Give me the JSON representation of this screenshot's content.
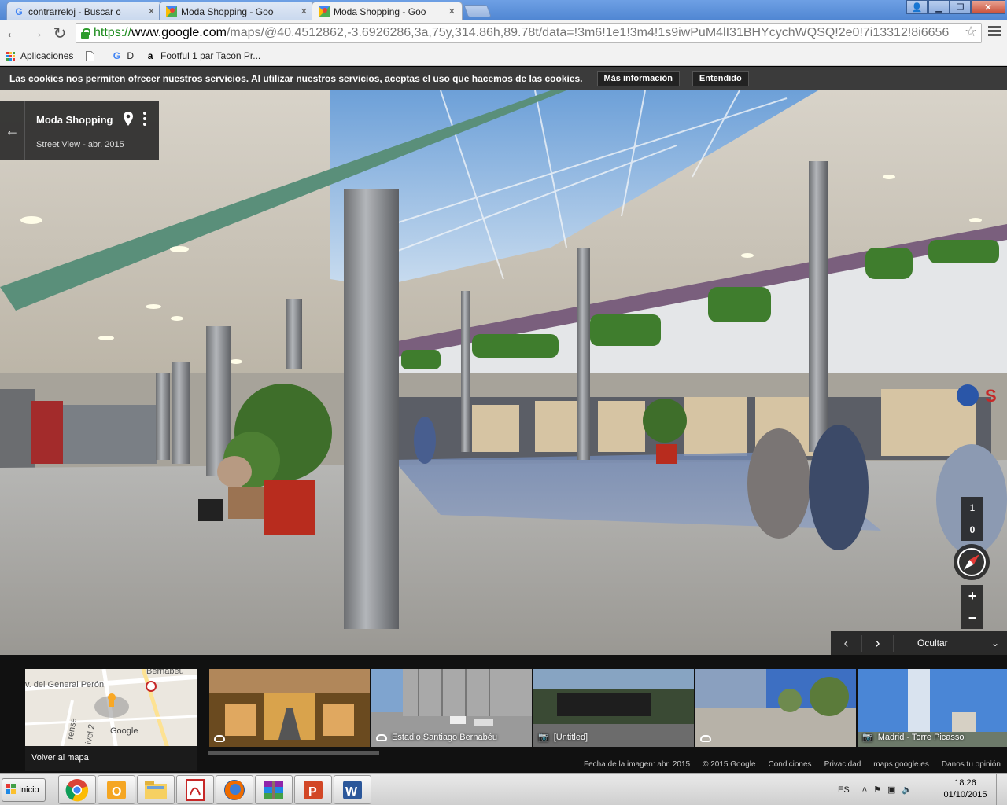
{
  "browser": {
    "tabs": [
      {
        "label": "contrarreloj - Buscar con Goo",
        "icon": "google-g-icon",
        "active": false
      },
      {
        "label": "Moda Shopping - Google Map",
        "icon": "google-maps-icon",
        "active": false
      },
      {
        "label": "Moda Shopping - Google Map",
        "icon": "google-maps-icon",
        "active": true
      }
    ],
    "url": {
      "scheme": "https://",
      "host": "www.google.com",
      "path": "/maps/@40.4512862,-3.6926286,3a,75y,314.86h,89.78t/data=!3m6!1e1!3m4!1s9iwPuM4lI31BHYcychWQSQ!2e0!7i13312!8i6656"
    },
    "bookmarks": [
      {
        "label": "Aplicaciones",
        "icon": "apps-grid-icon"
      },
      {
        "label": "",
        "icon": "page-icon"
      },
      {
        "label": "D",
        "icon": "google-g-icon"
      },
      {
        "label": "Footful 1 par Tacón Pr...",
        "icon": "amazon-icon"
      }
    ]
  },
  "cookie_bar": {
    "text": "Las cookies nos permiten ofrecer nuestros servicios. Al utilizar nuestros servicios, aceptas el uso que hacemos de las cookies.",
    "more_label": "Más información",
    "ok_label": "Entendido"
  },
  "place_card": {
    "title": "Moda Shopping",
    "subtitle": "Street View - abr. 2015"
  },
  "levels": [
    "1",
    "0"
  ],
  "zoom": {
    "in": "+",
    "out": "−"
  },
  "strip_control": {
    "prev": "‹",
    "next": "›",
    "hide_label": "Ocultar",
    "chevron": "⌄"
  },
  "minimap": {
    "labels": [
      "Bernabéu",
      "v. del General Perón",
      "Google",
      "rense",
      "ivel 2"
    ],
    "back_label": "Volver al mapa"
  },
  "thumbnails": [
    {
      "caption": "",
      "icon": "panorama-icon",
      "colors": [
        "#6a4a1f",
        "#d9a34c"
      ]
    },
    {
      "caption": "Estadio Santiago Bernabéu",
      "icon": "panorama-icon",
      "colors": [
        "#4b6a8f",
        "#a9a9a9"
      ]
    },
    {
      "caption": "[Untitled]",
      "icon": "camera-icon",
      "colors": [
        "#87a4c2",
        "#3a4a34"
      ]
    },
    {
      "caption": "",
      "icon": "panorama-icon",
      "colors": [
        "#3d6fc2",
        "#6e8a4e"
      ]
    },
    {
      "caption": "Madrid - Torre Picasso",
      "icon": "camera-icon",
      "colors": [
        "#4a86d6",
        "#d9e3ef"
      ]
    }
  ],
  "footer_links": [
    "Fecha de la imagen: abr. 2015",
    "© 2015 Google",
    "Condiciones",
    "Privacidad",
    "maps.google.es",
    "Danos tu opinión"
  ],
  "taskbar": {
    "start_label": "Inicio",
    "apps": [
      "chrome-icon",
      "outlook-icon",
      "explorer-icon",
      "acrobat-icon",
      "firefox-icon",
      "winrar-icon",
      "powerpoint-icon",
      "word-icon"
    ],
    "lang": "ES",
    "time": "18:26",
    "date": "01/10/2015"
  }
}
